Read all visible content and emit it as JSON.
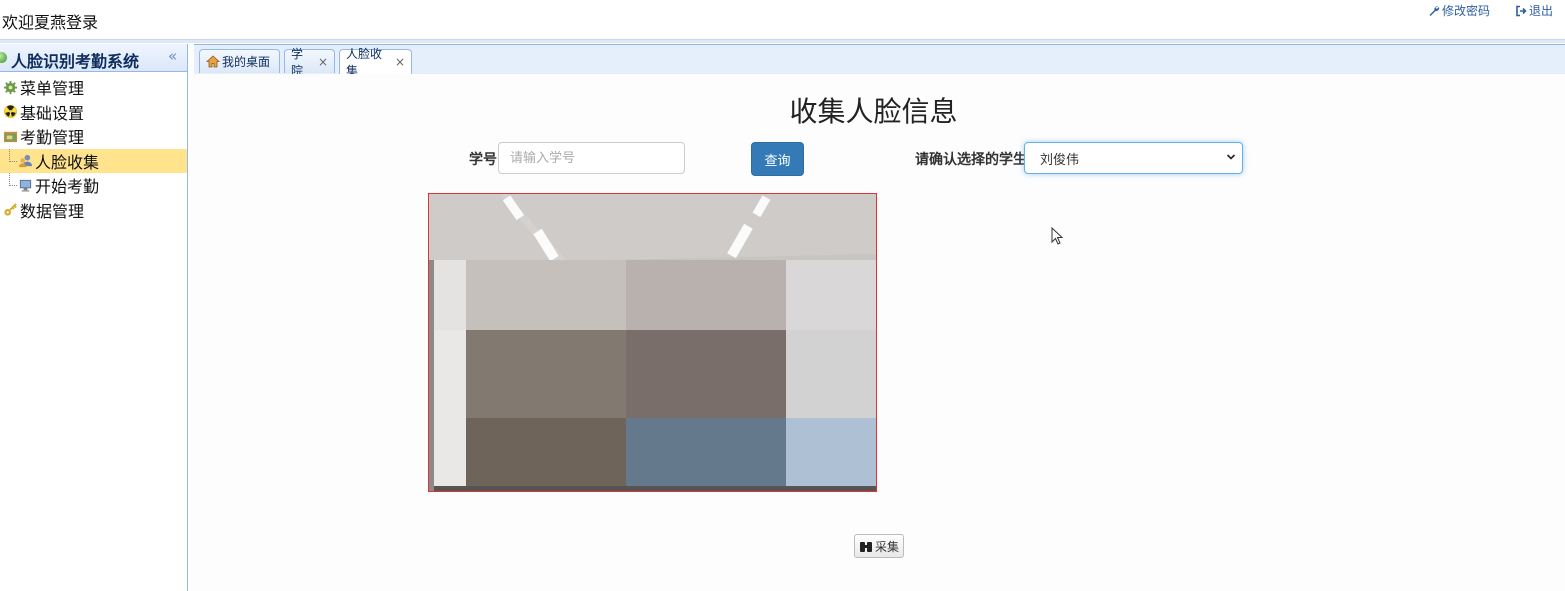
{
  "header": {
    "welcome": "欢迎夏燕登录",
    "change_password": "修改密码",
    "logout": "退出"
  },
  "sidebar": {
    "title": "人脸识别考勤系统",
    "collapse": "«",
    "items": [
      {
        "label": "菜单管理",
        "icon": "gear-icon"
      },
      {
        "label": "基础设置",
        "icon": "radiation-icon"
      },
      {
        "label": "考勤管理",
        "icon": "folder-icon"
      },
      {
        "label": "人脸收集",
        "icon": "users-icon",
        "child": true,
        "selected": true
      },
      {
        "label": "开始考勤",
        "icon": "monitor-icon",
        "child": true
      },
      {
        "label": "数据管理",
        "icon": "keys-icon"
      }
    ]
  },
  "tabs": [
    {
      "label": "我的桌面",
      "icon": "home-icon",
      "closable": false
    },
    {
      "label": "学院",
      "closable": true
    },
    {
      "label": "人脸收集",
      "closable": true,
      "active": true
    }
  ],
  "form": {
    "title": "收集人脸信息",
    "student_id_label": "学号",
    "student_id_placeholder": "请输入学号",
    "student_id_value": "",
    "query_button": "查询",
    "confirm_label": "请确认选择的学生",
    "selected_student": "刘俊伟"
  },
  "collect_button": "采集",
  "colors": {
    "primary_button": "#337ab7",
    "selected_tree": "#ffe48d",
    "border_blue": "#95b8e7"
  }
}
